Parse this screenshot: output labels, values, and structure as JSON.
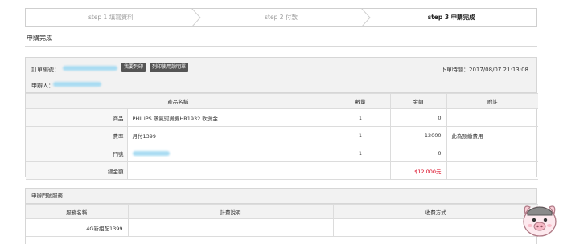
{
  "steps": [
    {
      "label": "step 1 填寫資料"
    },
    {
      "label": "step 2 付款"
    },
    {
      "label": "step 3 申購完成"
    }
  ],
  "page_title": "申購完成",
  "order": {
    "number_label": "訂單編號：",
    "print_button": "我要列印",
    "print_usage_button": "列印使用說明單",
    "time": "下單時間：2017/08/07 21:13:08",
    "applicant_label": "申辦人："
  },
  "items_table": {
    "headers": [
      "產品名稱",
      "數量",
      "金額",
      "附註"
    ],
    "rows": [
      {
        "key": "商品",
        "name": "PHILIPS 蒸氣熨燙機HR1932 吹燙金",
        "qty": "1",
        "amount": "0",
        "note": ""
      },
      {
        "key": "費率",
        "name": "月付1399",
        "qty": "1",
        "amount": "12000",
        "note": "此為預繳費用"
      },
      {
        "key": "門號",
        "name": "",
        "qty": "1",
        "amount": "0",
        "note": ""
      }
    ],
    "total_label": "總金額",
    "total_value": "$12,000元"
  },
  "plan": {
    "title": "申辦門號服務",
    "headers": [
      "服務名稱",
      "計費說明",
      "收費方式"
    ],
    "rows": [
      {
        "name": "4G新組配1399",
        "billing": "",
        "method": ""
      }
    ]
  },
  "colors": {
    "accent_red": "#d9001b",
    "blurred_text": "#a9dcf2"
  }
}
